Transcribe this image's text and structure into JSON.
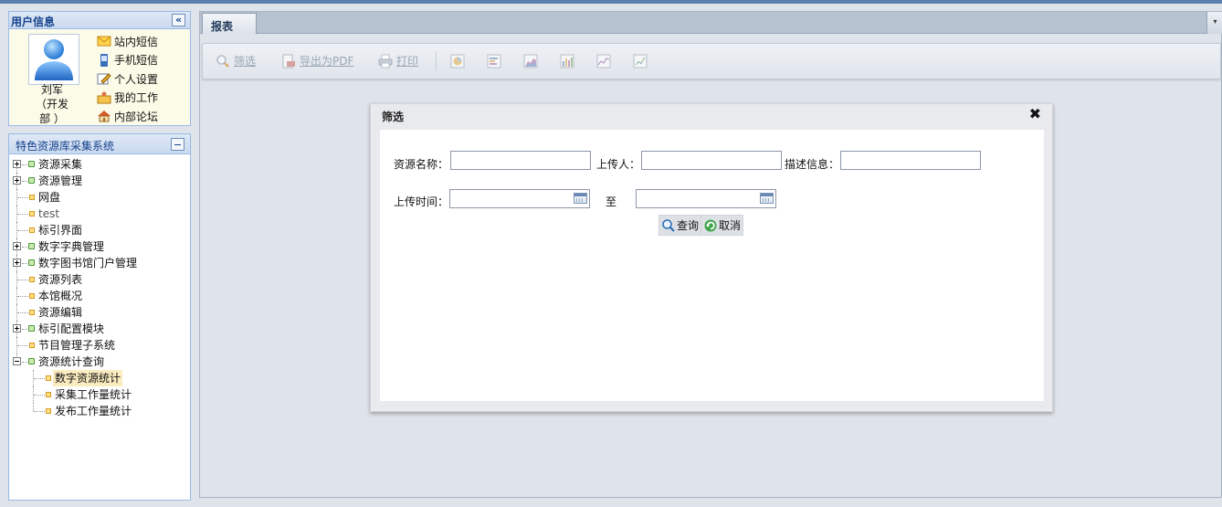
{
  "user_panel": {
    "title": "用户信息",
    "collapse_glyph": "«",
    "user_name": "刘军",
    "user_dept_line1": "（开发",
    "user_dept_line2": "部 ）",
    "links": [
      {
        "label": "站内短信",
        "icon": "envelope-icon"
      },
      {
        "label": "手机短信",
        "icon": "mobile-phone-icon"
      },
      {
        "label": "个人设置",
        "icon": "edit-icon"
      },
      {
        "label": "我的工作",
        "icon": "work-folder-icon"
      },
      {
        "label": "内部论坛",
        "icon": "home-icon"
      }
    ]
  },
  "tree_panel": {
    "title": "特色资源库采集系统",
    "items": [
      {
        "label": "资源采集",
        "type": "folder",
        "state": "collapsed"
      },
      {
        "label": "资源管理",
        "type": "folder",
        "state": "collapsed"
      },
      {
        "label": "网盘",
        "type": "leaf"
      },
      {
        "label": "test",
        "type": "leaf"
      },
      {
        "label": "标引界面",
        "type": "leaf"
      },
      {
        "label": "数字字典管理",
        "type": "folder",
        "state": "collapsed"
      },
      {
        "label": "数字图书馆门户管理",
        "type": "folder",
        "state": "collapsed"
      },
      {
        "label": "资源列表",
        "type": "leaf"
      },
      {
        "label": "本馆概况",
        "type": "leaf"
      },
      {
        "label": "资源编辑",
        "type": "leaf"
      },
      {
        "label": "标引配置模块",
        "type": "folder",
        "state": "collapsed"
      },
      {
        "label": "节目管理子系统",
        "type": "leaf"
      },
      {
        "label": "资源统计查询",
        "type": "folder",
        "state": "expanded"
      },
      {
        "label": "数字资源统计",
        "type": "child",
        "selected": true
      },
      {
        "label": "采集工作量统计",
        "type": "child"
      },
      {
        "label": "发布工作量统计",
        "type": "child"
      }
    ]
  },
  "tabs": {
    "active_label": "报表",
    "menu_glyph": "▾"
  },
  "toolbar": {
    "filter_label": "筛选",
    "export_pdf_label": "导出为PDF",
    "print_label": "打印",
    "chart_icons": [
      "pie-chart-icon",
      "bar-chart-h-icon",
      "area-chart-icon",
      "column-chart-icon",
      "line-chart-icon",
      "scatter-chart-icon"
    ]
  },
  "dialog": {
    "title": "筛选",
    "close_glyph": "✖",
    "fields": {
      "resource_name_label": "资源名称：",
      "resource_name_value": "",
      "uploader_label": "上传人：",
      "uploader_value": "",
      "description_label": "描述信息：",
      "description_value": "",
      "upload_time_label": "上传时间：",
      "time_start_value": "",
      "to_label": "至",
      "time_end_value": ""
    },
    "query_button": "查询",
    "cancel_button": "取消"
  },
  "colors": {
    "accent": "#15428b",
    "panel_border": "#99bbe8",
    "selected_bg": "#fbecc0"
  }
}
